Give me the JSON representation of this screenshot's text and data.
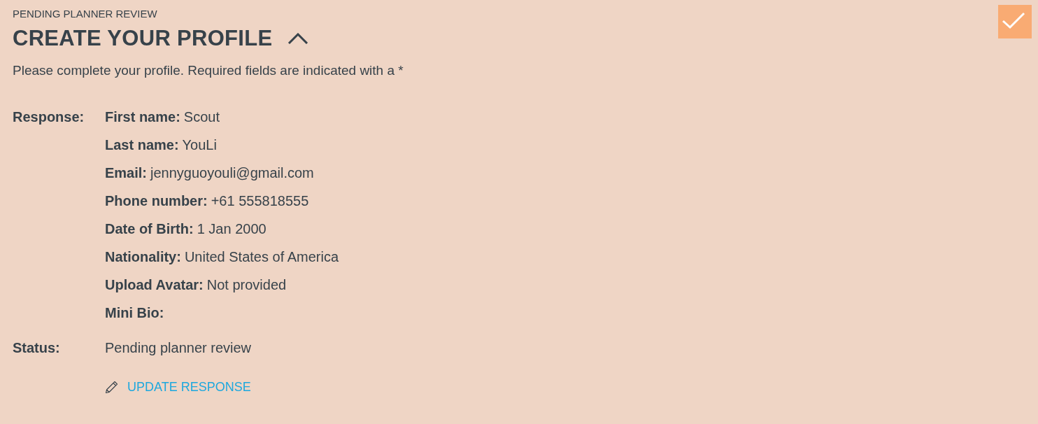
{
  "section": {
    "overline": "PENDING PLANNER REVIEW",
    "title": "CREATE YOUR PROFILE",
    "expanded": true,
    "complete": true
  },
  "intro": "Please complete your profile. Required fields are indicated with a *",
  "response": {
    "label": "Response:",
    "fields": [
      {
        "label": "First name:",
        "value": "Scout"
      },
      {
        "label": "Last name:",
        "value": "YouLi"
      },
      {
        "label": "Email:",
        "value": "jennyguoyouli@gmail.com"
      },
      {
        "label": "Phone number:",
        "value": "+61 555818555"
      },
      {
        "label": "Date of Birth:",
        "value": "1 Jan 2000"
      },
      {
        "label": "Nationality:",
        "value": "United States of America"
      },
      {
        "label": "Upload Avatar:",
        "value": "Not provided"
      },
      {
        "label": "Mini Bio:"
      }
    ]
  },
  "status": {
    "label": "Status:",
    "value": "Pending planner review"
  },
  "action": {
    "label": "UPDATE RESPONSE"
  }
}
